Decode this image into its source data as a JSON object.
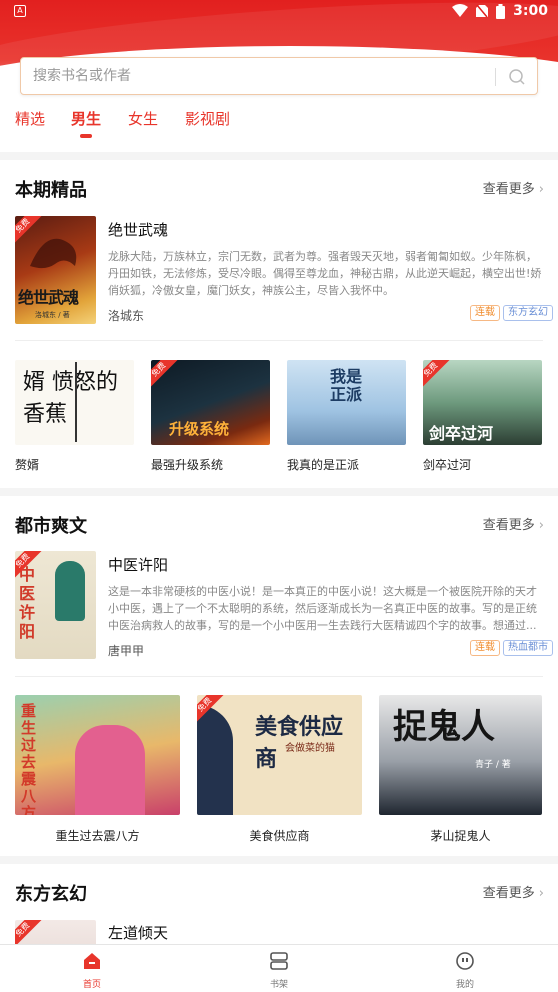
{
  "status_bar": {
    "app_icon": "A",
    "time": "3:00"
  },
  "search": {
    "placeholder": "搜索书名或作者"
  },
  "tabs": [
    {
      "label": "精选",
      "active": false
    },
    {
      "label": "男生",
      "active": true
    },
    {
      "label": "女生",
      "active": false
    },
    {
      "label": "影视剧",
      "active": false
    }
  ],
  "sections": [
    {
      "title": "本期精品",
      "more": "查看更多",
      "feature": {
        "name": "绝世武魂",
        "desc": "龙脉大陆，万族林立，宗门无数，武者为尊。强者毁天灭地，弱者匍匐如蚁。少年陈枫，丹田如铁，无法修炼，受尽冷眼。偶得至尊龙血，神秘古鼎，从此逆天崛起，横空出世!娇俏妖狐，冷傲女皇，魔门妖女，神族公主，尽皆入我怀中。",
        "author": "洛城东",
        "tags": [
          "连载",
          "东方玄幻"
        ],
        "cover_text": "绝世武魂",
        "cover_author": "洛城东 / 著",
        "free": "免费"
      },
      "books": [
        {
          "title": "赘婿",
          "cover_text": "婿 愤怒的香蕉"
        },
        {
          "title": "最强升级系统",
          "cover_text": "升级系统",
          "free": "免费"
        },
        {
          "title": "我真的是正派",
          "cover_text": "我是正派"
        },
        {
          "title": "剑卒过河",
          "cover_text": "剑卒过河",
          "free": "免费"
        }
      ]
    },
    {
      "title": "都市爽文",
      "more": "查看更多",
      "feature": {
        "name": "中医许阳",
        "desc": "这是一本非常硬核的中医小说！是一本真正的中医小说！这大概是一个被医院开除的天才小中医，遇上了一个不太聪明的系统，然后逐渐成长为一名真正中医的故事。写的是正统中医治病救人的故事，写的是一个小中医用一生去践行大医精诚四个字的故事。想通过...",
        "author": "唐甲甲",
        "tags": [
          "连载",
          "热血都市"
        ],
        "cover_text": "中医许阳",
        "free": "免费"
      },
      "books": [
        {
          "title": "重生过去震八方",
          "cover_text": "重生过去震八方"
        },
        {
          "title": "美食供应商",
          "cover_text": "美食供应商",
          "cover_sub": "会做菜的猫",
          "free": "免费"
        },
        {
          "title": "茅山捉鬼人",
          "cover_text": "捉鬼人",
          "cover_author": "青子 / 著"
        }
      ]
    },
    {
      "title": "东方玄幻",
      "more": "查看更多",
      "feature": {
        "name": "左道倾天"
      }
    }
  ],
  "bottom_nav": [
    {
      "label": "首页",
      "icon": "home-icon",
      "active": true
    },
    {
      "label": "书架",
      "icon": "bookshelf-icon",
      "active": false
    },
    {
      "label": "我的",
      "icon": "profile-icon",
      "active": false
    }
  ],
  "colors": {
    "accent": "#e8352b",
    "tag_orange": "#f08c2d",
    "tag_blue": "#6a8fd6"
  }
}
